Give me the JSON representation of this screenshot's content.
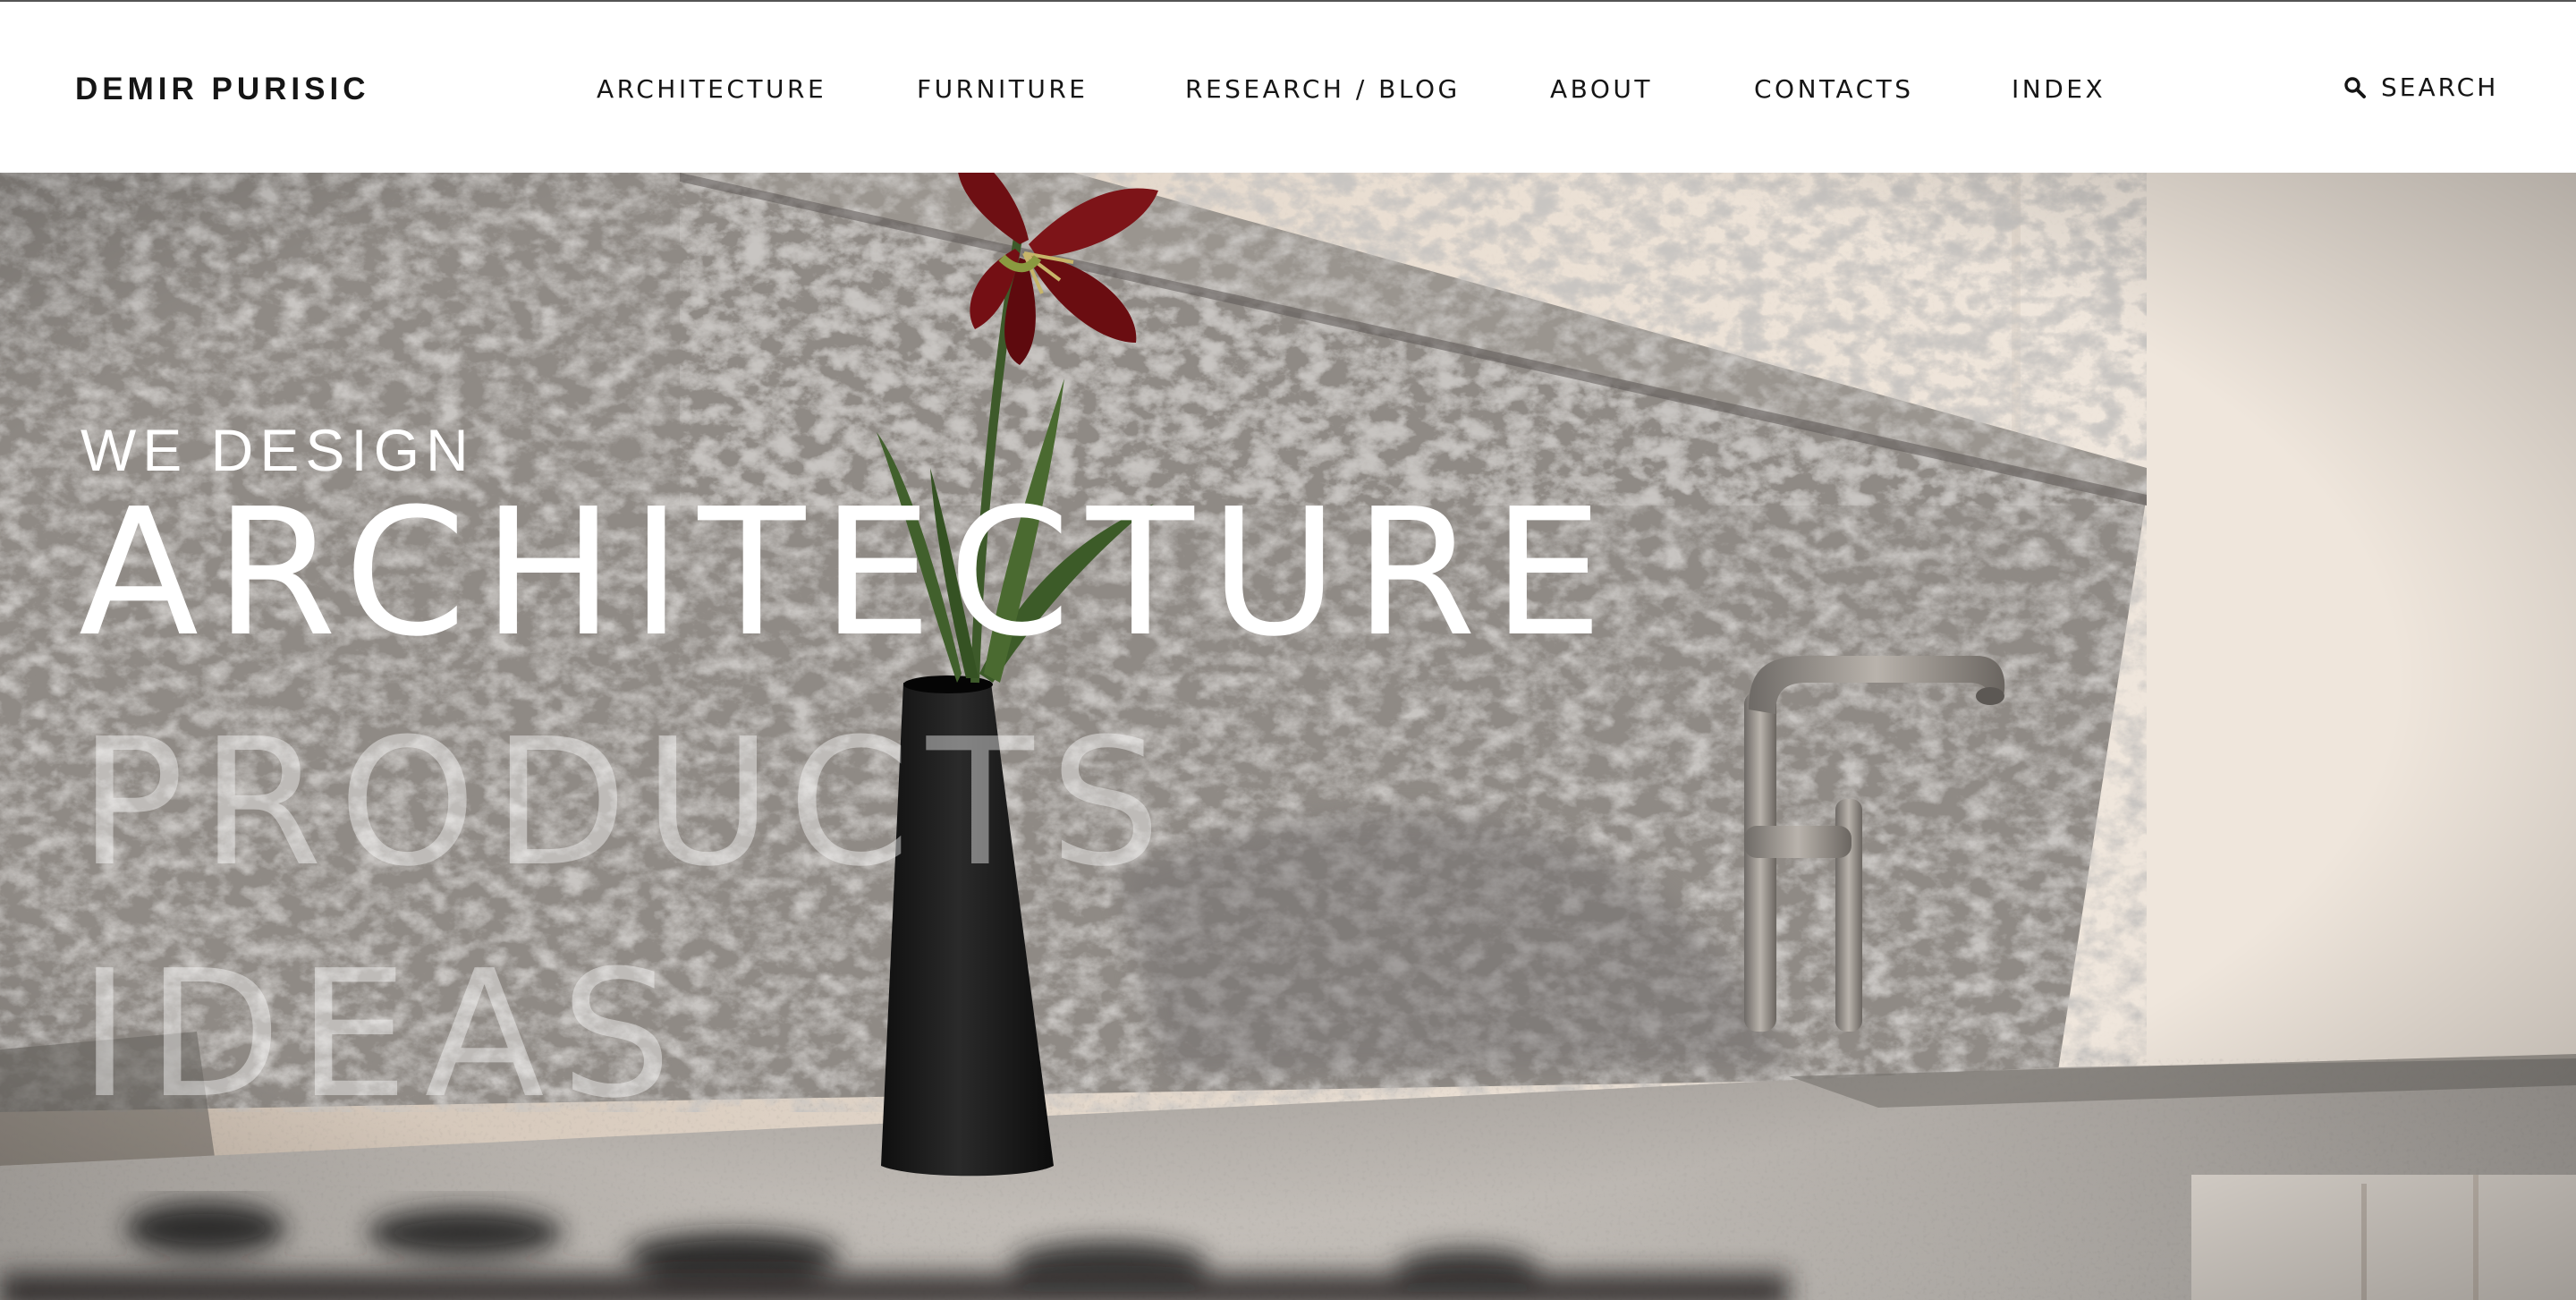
{
  "header": {
    "brand": "DEMIR PURISIC",
    "nav": [
      {
        "label": "ARCHITECTURE"
      },
      {
        "label": "FURNITURE"
      },
      {
        "label": "RESEARCH / BLOG"
      },
      {
        "label": "ABOUT"
      },
      {
        "label": "CONTACTS"
      },
      {
        "label": "INDEX"
      }
    ],
    "search_label": "SEARCH",
    "search_icon": "search-icon"
  },
  "hero": {
    "tagline": "WE DESIGN",
    "rotating_words": [
      {
        "text": "ARCHITECTURE",
        "state": "active"
      },
      {
        "text": "PRODUCTS",
        "state": "inactive"
      },
      {
        "text": "IDEAS",
        "state": "inactive"
      }
    ]
  },
  "colors": {
    "header_bg": "#ffffff",
    "text_dark": "#151515",
    "hero_text": "#ffffff",
    "hero_text_dim": "rgba(255,255,255,0.42)",
    "granite": "#8a8580",
    "wall_cream": "#e8dcd0",
    "flower_red": "#7a1014",
    "vase_black": "#1a1a1a"
  }
}
